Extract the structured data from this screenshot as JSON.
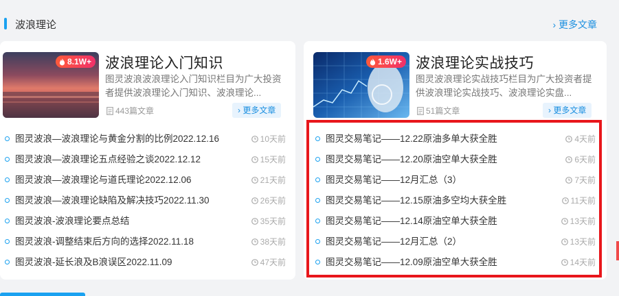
{
  "section": {
    "title": "波浪理论",
    "more": "› 更多文章"
  },
  "colors": {
    "accent": "#1aa1f0",
    "highlight": "#e8161b",
    "hot": "#f0306a"
  },
  "left_card": {
    "hot": "8.1W+",
    "title": "波浪理论入门知识",
    "desc": "图灵波浪波浪理论入门知识栏目为广大投资者提供波浪理论入门知识、波浪理论...",
    "count": "443篇文章",
    "more": "› 更多文章",
    "items": [
      {
        "title": "图灵波浪—波浪理论与黄金分割的比例2022.12.16",
        "time": "10天前"
      },
      {
        "title": "图灵波浪—波浪理论五点经验之谈2022.12.12",
        "time": "15天前"
      },
      {
        "title": "图灵波浪—波浪理论与道氏理论2022.12.06",
        "time": "21天前"
      },
      {
        "title": "图灵波浪—波浪理论缺陷及解决技巧2022.11.30",
        "time": "26天前"
      },
      {
        "title": "图灵波浪-波浪理论要点总结",
        "time": "35天前"
      },
      {
        "title": "图灵波浪-调整结束后方向的选择2022.11.18",
        "time": "38天前"
      },
      {
        "title": "图灵波浪-延长浪及B浪误区2022.11.09",
        "time": "47天前"
      }
    ]
  },
  "right_card": {
    "hot": "1.6W+",
    "title": "波浪理论实战技巧",
    "desc": "图灵波浪理论实战技巧栏目为广大投资者提供波浪理论实战技巧、波浪理论实盘...",
    "count": "51篇文章",
    "more": "› 更多文章",
    "items": [
      {
        "title": "图灵交易笔记——12.22原油多单大获全胜",
        "time": "4天前"
      },
      {
        "title": "图灵交易笔记——12.20原油空单大获全胜",
        "time": "6天前"
      },
      {
        "title": "图灵交易笔记——12月汇总（3）",
        "time": "7天前"
      },
      {
        "title": "图灵交易笔记——12.15原油多空均大获全胜",
        "time": "11天前"
      },
      {
        "title": "图灵交易笔记——12.14原油空单大获全胜",
        "time": "13天前"
      },
      {
        "title": "图灵交易笔记——12月汇总（2）",
        "time": "13天前"
      },
      {
        "title": "图灵交易笔记——12.09原油空单大获全胜",
        "time": "14天前"
      }
    ]
  },
  "icons": {
    "hot": "flame-icon",
    "count": "document-icon",
    "time": "clock-icon",
    "bullet": "circle-bullet-icon"
  }
}
